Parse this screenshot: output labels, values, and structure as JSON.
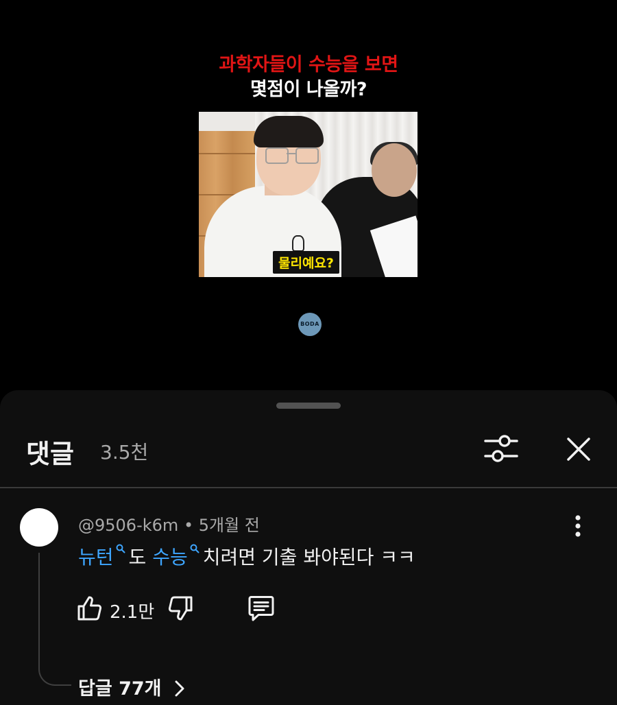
{
  "video": {
    "title_line1": "과학자들이 수능을 보면",
    "title_line2": "몇점이 나올까?",
    "caption": "물리예요?",
    "channel_logo_text": "BODA",
    "colors": {
      "title_accent": "#e01515",
      "caption_text": "#ffe600"
    }
  },
  "comments_panel": {
    "title": "댓글",
    "count": "3.5천",
    "filter_icon": "sliders-icon",
    "close_icon": "close-icon"
  },
  "comment": {
    "author": "@9506-k6m",
    "separator": "•",
    "time": "5개월 전",
    "segments": {
      "term1": "뉴턴",
      "text1": "도",
      "term2": "수능",
      "text2": "치려면 기출 봐야된다 ㅋㅋ"
    },
    "like_count": "2.1만",
    "replies_label": "답글 77개",
    "colors": {
      "link": "#3ea6ff"
    }
  }
}
